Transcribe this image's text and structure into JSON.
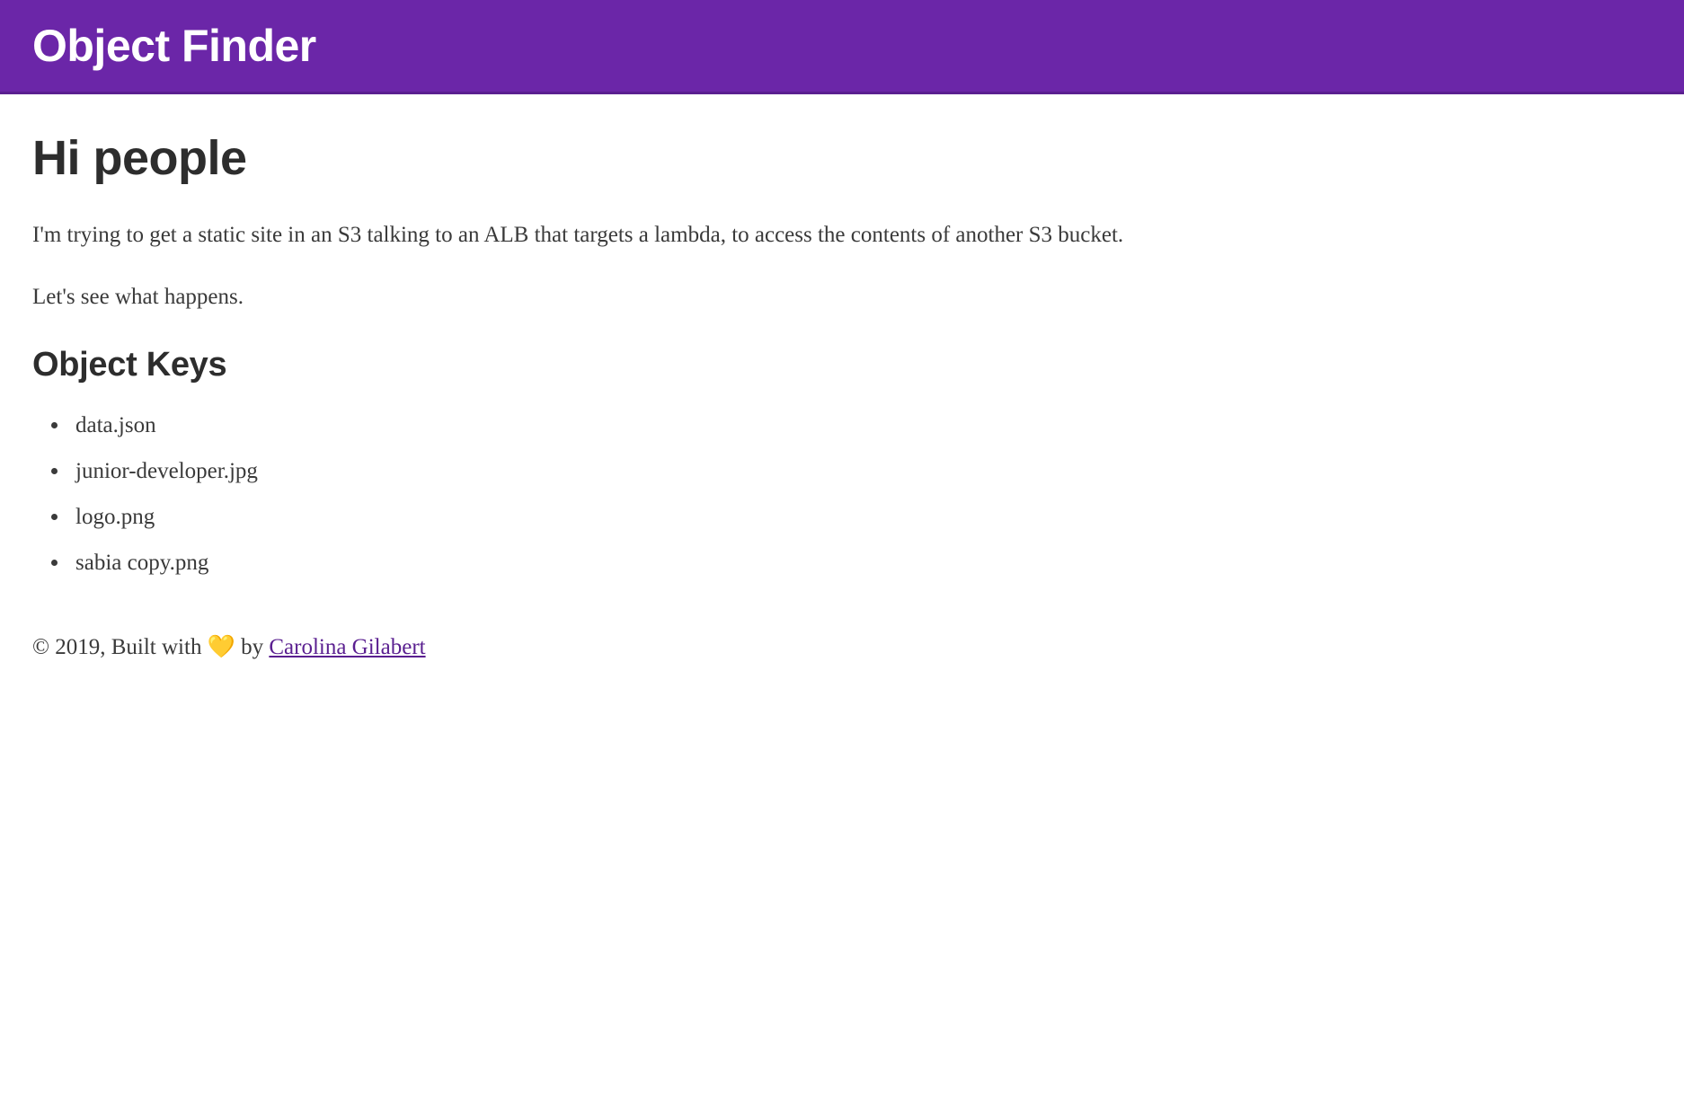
{
  "header": {
    "title": "Object Finder"
  },
  "main": {
    "greeting": "Hi people",
    "intro_p1": "I'm trying to get a static site in an S3 talking to an ALB that targets a lambda, to access the contents of another S3 bucket.",
    "intro_p2": "Let's see what happens.",
    "section_title": "Object Keys",
    "object_keys": [
      "data.json",
      "junior-developer.jpg",
      "logo.png",
      "sabia copy.png"
    ]
  },
  "footer": {
    "prefix": "© 2019, Built with ",
    "heart_emoji": "💛",
    "by_text": " by ",
    "author_name": "Carolina Gilabert"
  },
  "colors": {
    "header_bg": "#6b26a8",
    "link": "#5a1f90"
  }
}
